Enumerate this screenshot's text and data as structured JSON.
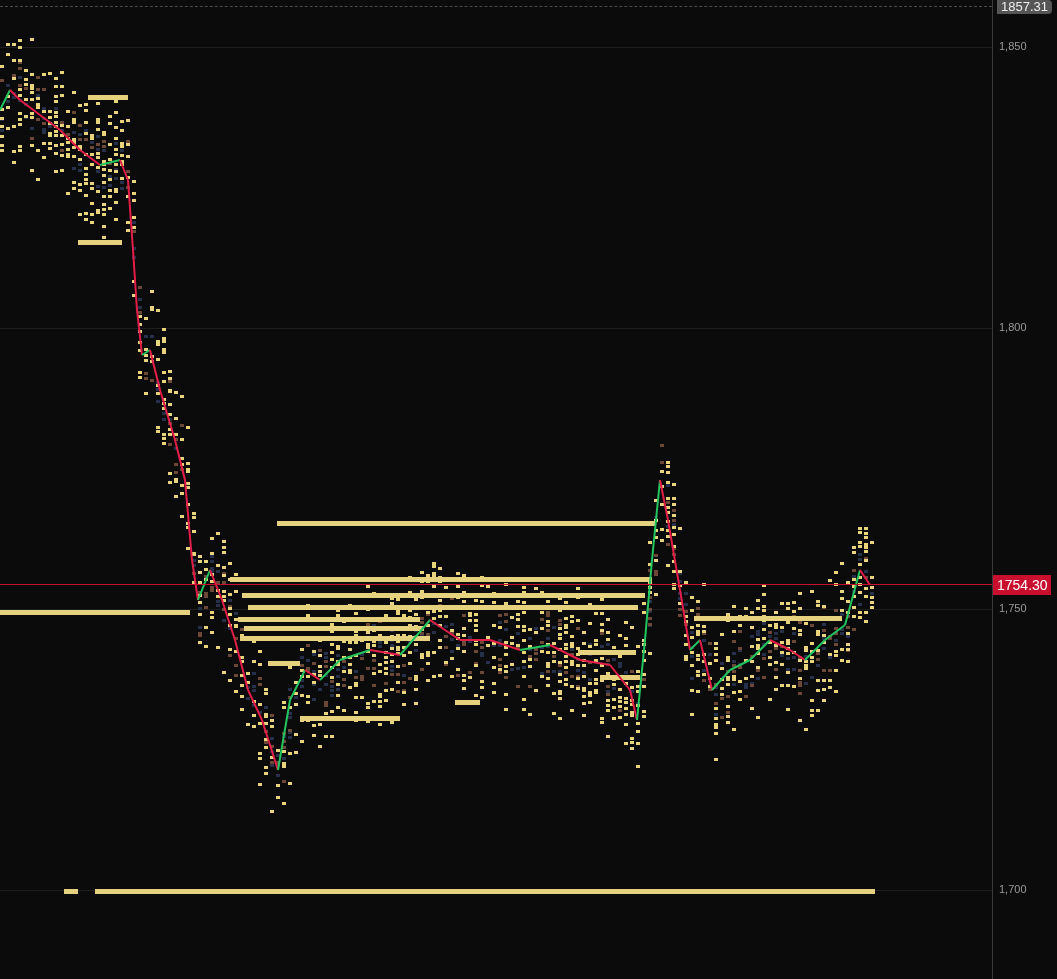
{
  "chart": {
    "top_marker": "1857.31",
    "last_price": "1754.30",
    "y_ticks": [
      "1,850",
      "1,800",
      "1,750",
      "1,700"
    ]
  }
}
